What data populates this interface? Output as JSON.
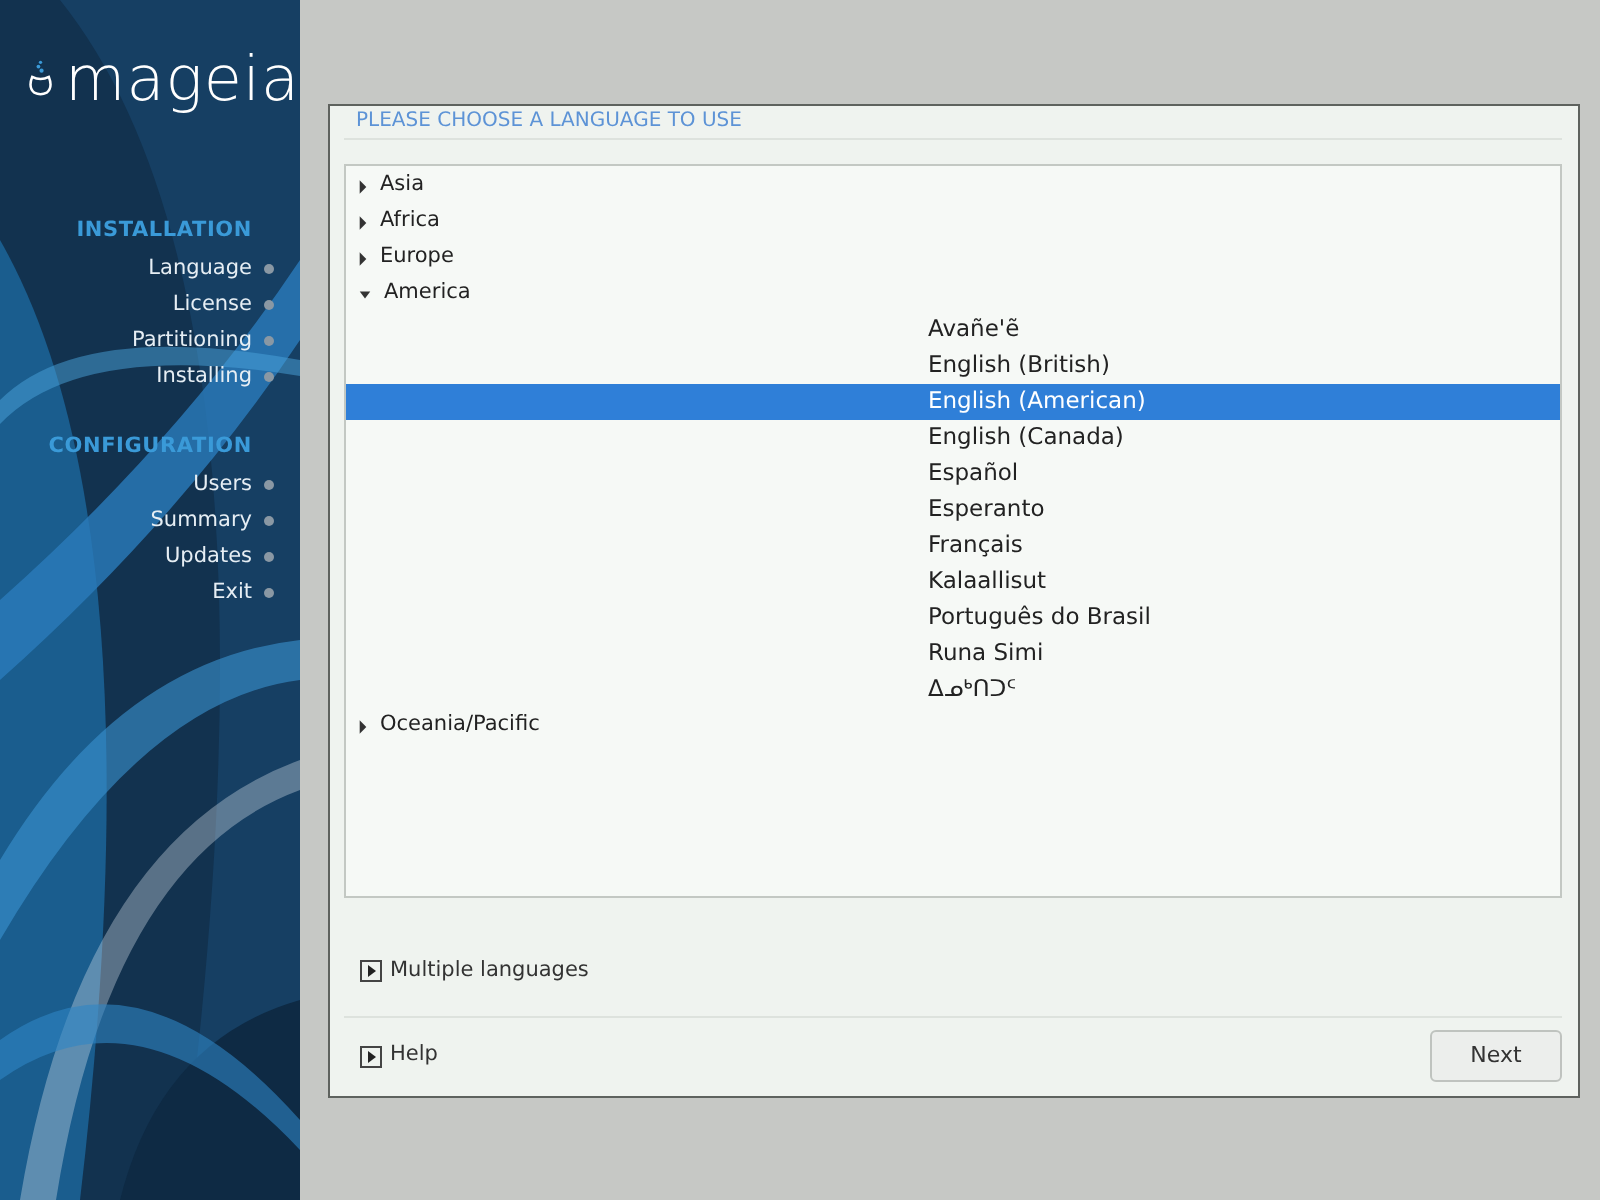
{
  "logo": {
    "text": "mageia"
  },
  "sidebar": {
    "sections": [
      {
        "title": "INSTALLATION",
        "items": [
          {
            "label": "Language"
          },
          {
            "label": "License"
          },
          {
            "label": "Partitioning"
          },
          {
            "label": "Installing"
          }
        ]
      },
      {
        "title": "CONFIGURATION",
        "items": [
          {
            "label": "Users"
          },
          {
            "label": "Summary"
          },
          {
            "label": "Updates"
          },
          {
            "label": "Exit"
          }
        ]
      }
    ]
  },
  "dialog": {
    "title": "PLEASE CHOOSE A LANGUAGE TO USE",
    "tree": [
      {
        "label": "Asia",
        "expanded": false
      },
      {
        "label": "Africa",
        "expanded": false
      },
      {
        "label": "Europe",
        "expanded": false
      },
      {
        "label": "America",
        "expanded": true,
        "children": [
          {
            "label": "Avañe'ẽ",
            "selected": false
          },
          {
            "label": "English (British)",
            "selected": false
          },
          {
            "label": "English (American)",
            "selected": true
          },
          {
            "label": "English (Canada)",
            "selected": false
          },
          {
            "label": "Español",
            "selected": false
          },
          {
            "label": "Esperanto",
            "selected": false
          },
          {
            "label": "Français",
            "selected": false
          },
          {
            "label": "Kalaallisut",
            "selected": false
          },
          {
            "label": "Português do Brasil",
            "selected": false
          },
          {
            "label": "Runa Simi",
            "selected": false
          },
          {
            "label": "ᐃᓄᒃᑎᑐᑦ",
            "selected": false
          }
        ]
      },
      {
        "label": "Oceania/Pacific",
        "expanded": false
      }
    ],
    "expanders": [
      {
        "label": "Multiple languages",
        "expanded": false
      }
    ],
    "help": {
      "label": "Help",
      "expanded": false
    },
    "next_button": "Next"
  }
}
